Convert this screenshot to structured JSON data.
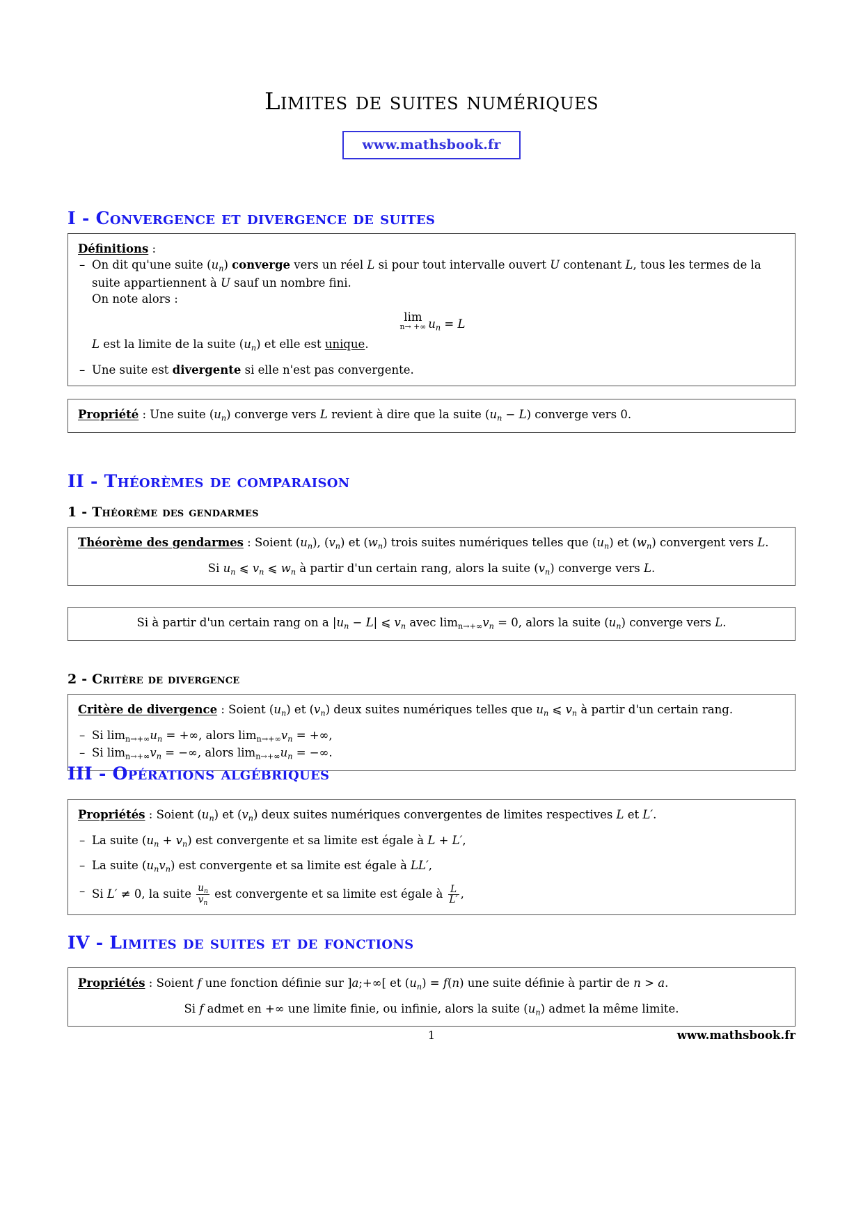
{
  "document": {
    "title": "Limites de suites numériques",
    "url_badge": "www.mathsbook.fr",
    "footer_page": "1",
    "footer_url": "www.mathsbook.fr",
    "accent_color": "#1a1aee",
    "badge_color": "#3333dd"
  },
  "sections": {
    "s1": {
      "heading": "I - Convergence et divergence de suites",
      "box1": {
        "label": "Définitions",
        "label_colon": " :",
        "item1_a": "On dit qu'une suite (",
        "item1_u": "u",
        "item1_n": "n",
        "item1_b": ") ",
        "item1_bold": "converge",
        "item1_c": " vers un réel ",
        "item1_L": "L",
        "item1_d": " si pour tout intervalle ouvert ",
        "item1_U": "U",
        "item1_e": " contenant ",
        "item1_L2": "L",
        "item1_f": ", tous les termes de la suite appartiennent à ",
        "item1_U2": "U",
        "item1_g": " sauf un nombre fini.",
        "item1_note": "On note alors :",
        "formula_lim": "lim",
        "formula_under": "n→ +∞",
        "formula_u": "u",
        "formula_sub": "n",
        "formula_eq": " = ",
        "formula_L": "L",
        "after_a": "L",
        "after_b": " est la limite de la suite (",
        "after_u": "u",
        "after_n": "n",
        "after_c": ") et elle est ",
        "after_unique": "unique",
        "after_d": ".",
        "item2_a": "Une suite est ",
        "item2_bold": "divergente",
        "item2_b": " si elle n'est pas convergente."
      },
      "box2": {
        "label": "Propriété",
        "t_a": " : Une suite (",
        "t_u": "u",
        "t_n": "n",
        "t_b": ") converge vers ",
        "t_L": "L",
        "t_c": " revient à dire que la suite (",
        "t_u2": "u",
        "t_n2": "n",
        "t_minus": " − ",
        "t_L2": "L",
        "t_d": ") converge vers 0."
      }
    },
    "s2": {
      "heading": "II - Théorèmes de comparaison",
      "sub1_heading": "1 - Théorème des gendarmes",
      "box3": {
        "label": "Théorème des gendarmes",
        "l_a": " : Soient (",
        "l_u": "u",
        "l_n1": "n",
        "l_b": "), (",
        "l_v": "v",
        "l_n2": "n",
        "l_c": ") et (",
        "l_w": "w",
        "l_n3": "n",
        "l_d": ") trois suites numériques telles que (",
        "l_u2": "u",
        "l_n4": "n",
        "l_e": ") et (",
        "l_w2": "w",
        "l_n5": "n",
        "l_f": ") convergent vers ",
        "l_L": "L",
        "l_g": ".",
        "c_si": "Si ",
        "c_u": "u",
        "c_n1": "n",
        "c_le1": " ⩽ ",
        "c_v": "v",
        "c_n2": "n",
        "c_le2": " ⩽ ",
        "c_w": "w",
        "c_n3": "n",
        "c_a": " à partir d'un certain rang, alors la suite (",
        "c_v2": "v",
        "c_n4": "n",
        "c_b": ") converge vers ",
        "c_L": "L",
        "c_c": "."
      },
      "box4": {
        "t_a": "Si à partir d'un certain rang on a |",
        "t_u": "u",
        "t_n1": "n",
        "t_minus": " − ",
        "t_L": "L",
        "t_b": "| ⩽ ",
        "t_v": "v",
        "t_n2": "n",
        "t_c": " avec lim",
        "t_sub": "n→+∞",
        "t_v2": "v",
        "t_n3": "n",
        "t_d": " = 0, alors la suite (",
        "t_u2": "u",
        "t_n4": "n",
        "t_e": ") converge vers ",
        "t_L2": "L",
        "t_f": "."
      },
      "sub2_heading": "2 - Critère de divergence",
      "box5": {
        "label": "Critère de divergence",
        "l_a": " : Soient (",
        "l_u": "u",
        "l_n1": "n",
        "l_b": ") et (",
        "l_v": "v",
        "l_n2": "n",
        "l_c": ") deux suites numériques telles que ",
        "l_u2": "u",
        "l_n3": "n",
        "l_le": " ⩽ ",
        "l_v2": "v",
        "l_n4": "n",
        "l_d": " à partir d'un certain rang.",
        "i1_a": "Si lim",
        "i1_sub1": "n→+∞",
        "i1_u": "u",
        "i1_n1": "n",
        "i1_b": " = +∞, alors lim",
        "i1_sub2": "n→+∞",
        "i1_v": "v",
        "i1_n2": "n",
        "i1_c": " = +∞,",
        "i2_a": "Si lim",
        "i2_sub1": "n→+∞",
        "i2_v": "v",
        "i2_n1": "n",
        "i2_b": " = −∞, alors lim",
        "i2_sub2": "n→+∞",
        "i2_u": "u",
        "i2_n2": "n",
        "i2_c": " = −∞."
      }
    },
    "s3": {
      "heading": "III - Opérations algébriques",
      "box6": {
        "label": "Propriétés",
        "l_a": " : Soient (",
        "l_u": "u",
        "l_n1": "n",
        "l_b": ") et (",
        "l_v": "v",
        "l_n2": "n",
        "l_c": ") deux suites numériques convergentes de limites respectives ",
        "l_L": "L",
        "l_d": " et ",
        "l_L2": "L",
        "l_prime": "′",
        "l_e": ".",
        "i1_a": "La suite (",
        "i1_u": "u",
        "i1_n1": "n",
        "i1_plus": " + ",
        "i1_v": "v",
        "i1_n2": "n",
        "i1_b": ") est convergente et sa limite est égale à ",
        "i1_L": "L",
        "i1_c": " + ",
        "i1_L2": "L",
        "i1_prime": "′",
        "i1_d": ",",
        "i2_a": "La suite (",
        "i2_u": "u",
        "i2_n1": "n",
        "i2_v": "v",
        "i2_n2": "n",
        "i2_b": ") est convergente et sa limite est égale à ",
        "i2_L": "LL",
        "i2_prime": "′",
        "i2_c": ",",
        "i3_a": "Si ",
        "i3_L": "L",
        "i3_prime": "′",
        "i3_b": " ≠ 0, la suite ",
        "i3_fnum_u": "u",
        "i3_fnum_n": "n",
        "i3_fden_v": "v",
        "i3_fden_n": "n",
        "i3_c": " est convergente et sa limite est égale à ",
        "i3_f2num": "L",
        "i3_f2den": "L",
        "i3_f2den_prime": "′",
        "i3_d": ","
      }
    },
    "s4": {
      "heading": "IV - Limites de suites et de fonctions",
      "box7": {
        "label": "Propriétés",
        "l_a": " : Soient ",
        "l_f": "f",
        "l_b": " une fonction définie sur ]",
        "l_aa": "a",
        "l_c": ";+∞[ et (",
        "l_u": "u",
        "l_n": "n",
        "l_d": ") = ",
        "l_f2": "f",
        "l_e": "(",
        "l_nn": "n",
        "l_f3": ") une suite définie à partir de ",
        "l_n2": "n",
        "l_g": " > ",
        "l_a2": "a",
        "l_h": ".",
        "c_a": "Si ",
        "c_f": "f",
        "c_b": " admet en +∞ une limite finie, ou infinie, alors la suite (",
        "c_u": "u",
        "c_n": "n",
        "c_c": ") admet la même limite."
      }
    }
  }
}
